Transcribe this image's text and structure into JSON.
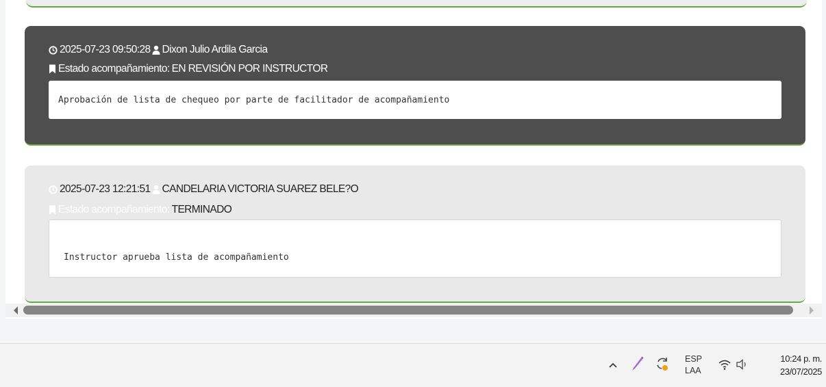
{
  "entries": [
    {
      "timestamp": "2025-07-23 09:50:28",
      "author": "Dixon Julio Ardila Garcia",
      "status_label": "Estado acompañamiento:",
      "status_value": "EN REVISIÓN POR INSTRUCTOR",
      "comment": "Aprobación de lista de chequeo por parte de facilitador de acompañamiento"
    },
    {
      "timestamp": "2025-07-23 12:21:51",
      "author": "CANDELARIA VICTORIA SUAREZ BELE?O",
      "status_label": "Estado acompañamiento:",
      "status_value": "TERMINADO",
      "comment": "Instructor aprueba lista de acompañamiento"
    }
  ],
  "icons": {
    "clock": "clock-icon",
    "user": "user-icon",
    "bookmark": "bookmark-icon"
  },
  "colors": {
    "dark_card": "#4e4e4e",
    "light_card": "#e9e9e9",
    "accent_border": "#63ad3c"
  },
  "taskbar": {
    "lang_primary": "ESP",
    "lang_secondary": "LAA",
    "time": "10:24 p. m.",
    "date": "23/07/2025"
  }
}
